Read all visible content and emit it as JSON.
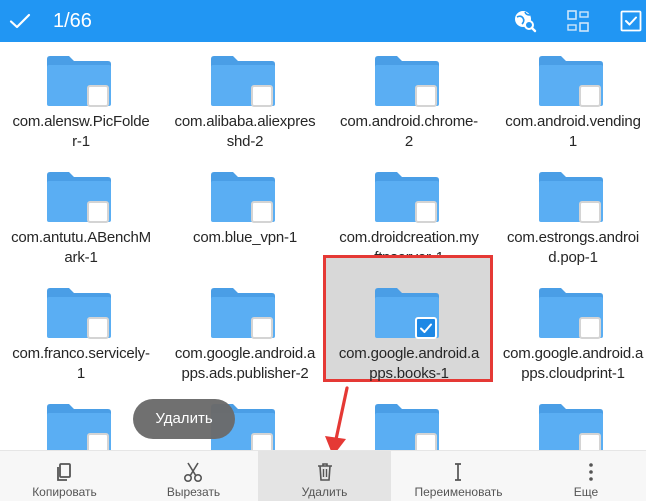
{
  "topbar": {
    "count": "1/66",
    "bg": "#2196f3",
    "icons": [
      "check-icon",
      "search-web-icon",
      "transfer-icon",
      "select-all-icon"
    ]
  },
  "items": [
    {
      "label": "com.alensw.PicFolder-1",
      "lines": [
        "com.alensw.PicFolde",
        "r-1"
      ],
      "checked": false
    },
    {
      "label": "com.alibaba.aliexpresshd-2",
      "lines": [
        "com.alibaba.aliexpres",
        "shd-2"
      ],
      "checked": false
    },
    {
      "label": "com.android.chrome-2",
      "lines": [
        "com.android.chrome-",
        "2"
      ],
      "checked": false
    },
    {
      "label": "com.android.vending-1",
      "lines": [
        "com.android.vending",
        "1"
      ],
      "checked": false
    },
    {
      "label": "com.antutu.ABenchMark-1",
      "lines": [
        "com.antutu.ABenchM",
        "ark-1"
      ],
      "checked": false
    },
    {
      "label": "com.blue_vpn-1",
      "lines": [
        "com.blue_vpn-1"
      ],
      "checked": false
    },
    {
      "label": "com.droidcreation.myftpserver-1",
      "lines": [
        "com.droidcreation.my",
        "ftpserver-1"
      ],
      "checked": false
    },
    {
      "label": "com.estrongs.android.pop-1",
      "lines": [
        "com.estrongs.androi",
        "d.pop-1"
      ],
      "checked": false
    },
    {
      "label": "com.franco.servicely-1",
      "lines": [
        "com.franco.servicely-",
        "1"
      ],
      "checked": false
    },
    {
      "label": "com.google.android.apps.ads.publisher-2",
      "lines": [
        "com.google.android.a",
        "pps.ads.publisher-2"
      ],
      "checked": false
    },
    {
      "label": "com.google.android.apps.books-1",
      "lines": [
        "com.google.android.a",
        "pps.books-1"
      ],
      "checked": true
    },
    {
      "label": "com.google.android.apps.cloudprint-1",
      "lines": [
        "com.google.android.a",
        "pps.cloudprint-1"
      ],
      "checked": false
    },
    {
      "label": "",
      "lines": [],
      "checked": false
    },
    {
      "label": "",
      "lines": [],
      "checked": false
    },
    {
      "label": "",
      "lines": [],
      "checked": false
    },
    {
      "label": "",
      "lines": [],
      "checked": false
    }
  ],
  "toast": "Удалить",
  "bottombar": [
    {
      "label": "Копировать",
      "icon": "copy-icon"
    },
    {
      "label": "Вырезать",
      "icon": "scissors-icon"
    },
    {
      "label": "Удалить",
      "icon": "trash-icon"
    },
    {
      "label": "Переименовать",
      "icon": "text-cursor-icon"
    },
    {
      "label": "Еще",
      "icon": "more-vertical-icon"
    }
  ],
  "colors": {
    "folder": "#5aaef3",
    "folder_tab": "#4a9ee6",
    "highlight": "#e53935",
    "checked_box": "#1e88e5"
  }
}
